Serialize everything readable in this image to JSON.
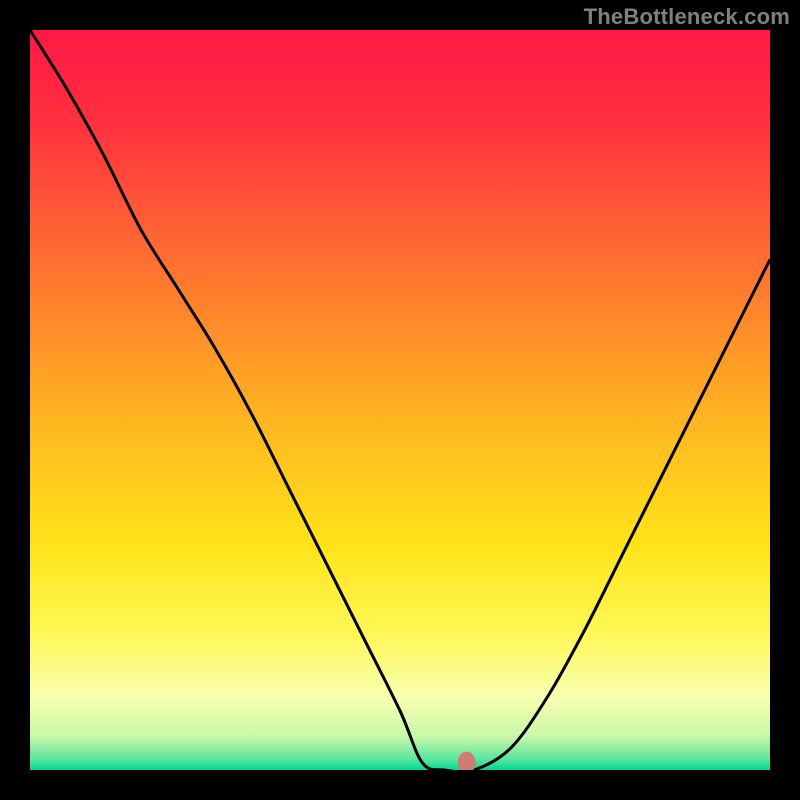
{
  "watermark": "TheBottleneck.com",
  "chart_data": {
    "type": "line",
    "title": "",
    "xlabel": "",
    "ylabel": "",
    "xlim": [
      0,
      100
    ],
    "ylim": [
      0,
      100
    ],
    "grid": false,
    "legend": false,
    "series": [
      {
        "name": "bottleneck-curve",
        "x": [
          0,
          5,
          10,
          15,
          20,
          25,
          30,
          35,
          40,
          45,
          50,
          53,
          56,
          60,
          65,
          70,
          75,
          80,
          85,
          90,
          95,
          100
        ],
        "values": [
          100,
          92,
          83,
          73,
          65,
          57,
          48,
          38,
          28,
          18,
          8,
          1,
          0,
          0,
          3,
          10,
          19,
          29,
          39,
          49,
          59,
          69
        ]
      }
    ],
    "marker": {
      "x": 59,
      "y": 1,
      "color": "#cd7d71"
    },
    "gradient_stops": [
      {
        "offset": 0.0,
        "color": "#ff1846"
      },
      {
        "offset": 0.12,
        "color": "#ff2f3f"
      },
      {
        "offset": 0.25,
        "color": "#ff5a36"
      },
      {
        "offset": 0.4,
        "color": "#ff8c2a"
      },
      {
        "offset": 0.55,
        "color": "#ffbc1f"
      },
      {
        "offset": 0.7,
        "color": "#ffe41a"
      },
      {
        "offset": 0.82,
        "color": "#fff85a"
      },
      {
        "offset": 0.9,
        "color": "#f9ffb0"
      },
      {
        "offset": 0.955,
        "color": "#c9f7a8"
      },
      {
        "offset": 0.985,
        "color": "#5ce6a0"
      },
      {
        "offset": 1.0,
        "color": "#00d991"
      }
    ]
  }
}
